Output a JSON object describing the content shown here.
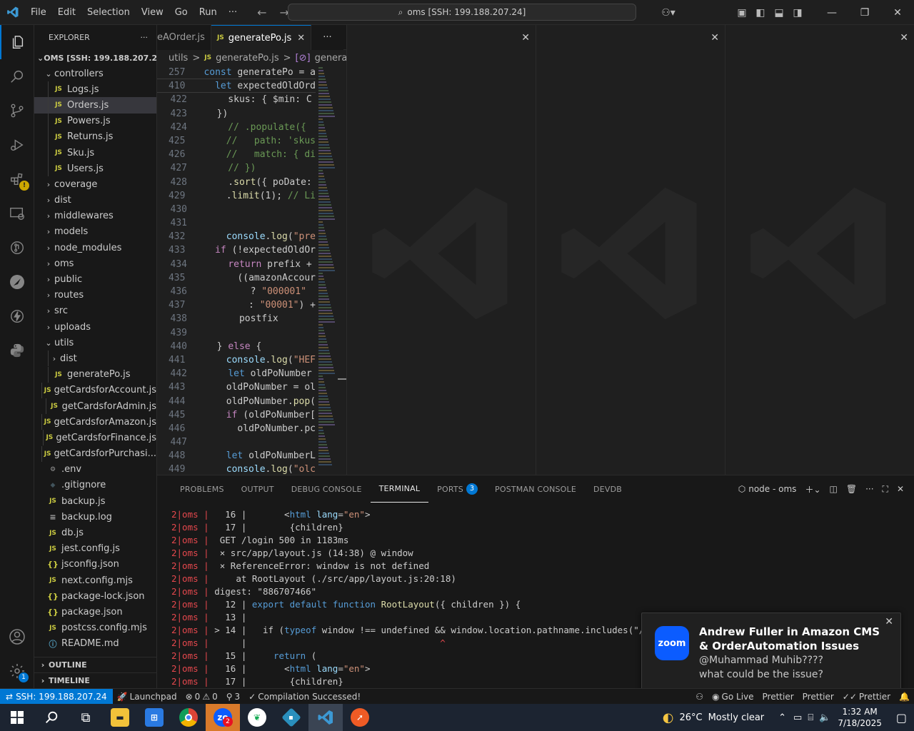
{
  "titlebar": {
    "menu": [
      "File",
      "Edit",
      "Selection",
      "View",
      "Go",
      "Run",
      "···"
    ],
    "command_center": "oms [SSH: 199.188.207.24]"
  },
  "explorer": {
    "header": "EXPLORER",
    "root": "OMS [SSH: 199.188.207.24]",
    "items": [
      {
        "label": "controllers",
        "kind": "folder-open",
        "depth": 1
      },
      {
        "label": "Logs.js",
        "kind": "js",
        "depth": 2
      },
      {
        "label": "Orders.js",
        "kind": "js",
        "depth": 2,
        "selected": true
      },
      {
        "label": "Powers.js",
        "kind": "js",
        "depth": 2
      },
      {
        "label": "Returns.js",
        "kind": "js",
        "depth": 2
      },
      {
        "label": "Sku.js",
        "kind": "js",
        "depth": 2
      },
      {
        "label": "Users.js",
        "kind": "js",
        "depth": 2
      },
      {
        "label": "coverage",
        "kind": "folder",
        "depth": 1
      },
      {
        "label": "dist",
        "kind": "folder",
        "depth": 1
      },
      {
        "label": "middlewares",
        "kind": "folder",
        "depth": 1
      },
      {
        "label": "models",
        "kind": "folder",
        "depth": 1
      },
      {
        "label": "node_modules",
        "kind": "folder",
        "depth": 1
      },
      {
        "label": "oms",
        "kind": "folder",
        "depth": 1
      },
      {
        "label": "public",
        "kind": "folder",
        "depth": 1
      },
      {
        "label": "routes",
        "kind": "folder",
        "depth": 1
      },
      {
        "label": "src",
        "kind": "folder",
        "depth": 1
      },
      {
        "label": "uploads",
        "kind": "folder",
        "depth": 1
      },
      {
        "label": "utils",
        "kind": "folder-open",
        "depth": 1
      },
      {
        "label": "dist",
        "kind": "folder",
        "depth": 2
      },
      {
        "label": "generatePo.js",
        "kind": "js",
        "depth": 2
      },
      {
        "label": "getCardsforAccount.js",
        "kind": "js",
        "depth": 2
      },
      {
        "label": "getCardsforAdmin.js",
        "kind": "js",
        "depth": 2
      },
      {
        "label": "getCardsforAmazon.js",
        "kind": "js",
        "depth": 2
      },
      {
        "label": "getCardsforFinance.js",
        "kind": "js",
        "depth": 2
      },
      {
        "label": "getCardsforPurchasi...",
        "kind": "js",
        "depth": 2
      },
      {
        "label": ".env",
        "kind": "env",
        "depth": 1
      },
      {
        "label": ".gitignore",
        "kind": "git",
        "depth": 1
      },
      {
        "label": "backup.js",
        "kind": "js",
        "depth": 1
      },
      {
        "label": "backup.log",
        "kind": "log",
        "depth": 1
      },
      {
        "label": "db.js",
        "kind": "js",
        "depth": 1
      },
      {
        "label": "jest.config.js",
        "kind": "js",
        "depth": 1
      },
      {
        "label": "jsconfig.json",
        "kind": "json",
        "depth": 1
      },
      {
        "label": "next.config.mjs",
        "kind": "js",
        "depth": 1
      },
      {
        "label": "package-lock.json",
        "kind": "json",
        "depth": 1
      },
      {
        "label": "package.json",
        "kind": "json",
        "depth": 1
      },
      {
        "label": "postcss.config.mjs",
        "kind": "js",
        "depth": 1
      },
      {
        "label": "README.md",
        "kind": "md",
        "depth": 1
      }
    ],
    "outline": "OUTLINE",
    "timeline": "TIMELINE"
  },
  "editor": {
    "tabs": [
      {
        "label": "eAOrder.js",
        "active": false
      },
      {
        "label": "generatePo.js",
        "active": true
      }
    ],
    "tab_more": "···",
    "breadcrumbs": [
      "utils",
      ">",
      "generatePo.js",
      ">",
      "generatePo"
    ],
    "sticky": [
      {
        "n": "257",
        "code": "const generatePo = a"
      },
      {
        "n": "410",
        "code": "  let expectedOldOrd"
      }
    ],
    "lines": [
      {
        "n": "422",
        "code": "    skus: { $min: C"
      },
      {
        "n": "423",
        "code": "  })"
      },
      {
        "n": "424",
        "code": "    // .populate({"
      },
      {
        "n": "425",
        "code": "    //   path: 'skus"
      },
      {
        "n": "426",
        "code": "    //   match: { di"
      },
      {
        "n": "427",
        "code": "    // })"
      },
      {
        "n": "428",
        "code": "    .sort({ poDate:"
      },
      {
        "n": "429",
        "code": "    .limit(1); // Li"
      },
      {
        "n": "430",
        "code": ""
      },
      {
        "n": "431",
        "code": ""
      },
      {
        "n": "432",
        "code": "    console.log(\"pre"
      },
      {
        "n": "433",
        "code": "  if (!expectedOldOr"
      },
      {
        "n": "434",
        "code": "    return prefix +"
      },
      {
        "n": "435",
        "code": "      ((amazonAccour"
      },
      {
        "n": "436",
        "code": "        ? \"000001\""
      },
      {
        "n": "437",
        "code": "        : \"00001\") +"
      },
      {
        "n": "438",
        "code": "      postfix"
      },
      {
        "n": "439",
        "code": ""
      },
      {
        "n": "440",
        "code": "  } else {"
      },
      {
        "n": "441",
        "code": "    console.log(\"HEF"
      },
      {
        "n": "442",
        "code": "    let oldPoNumber"
      },
      {
        "n": "443",
        "code": "    oldPoNumber = ol"
      },
      {
        "n": "444",
        "code": "    oldPoNumber.pop("
      },
      {
        "n": "445",
        "code": "    if (oldPoNumber["
      },
      {
        "n": "446",
        "code": "      oldPoNumber.pc"
      },
      {
        "n": "447",
        "code": ""
      },
      {
        "n": "448",
        "code": "    let oldPoNumberL"
      },
      {
        "n": "449",
        "code": "    console.log(\"olc"
      }
    ]
  },
  "panel": {
    "tabs": [
      "PROBLEMS",
      "OUTPUT",
      "DEBUG CONSOLE",
      "TERMINAL",
      "PORTS",
      "POSTMAN CONSOLE",
      "DEVDB"
    ],
    "ports_badge": "3",
    "terminal_name": "node - oms",
    "lines": [
      {
        "p": "2|oms",
        "sep": " | ",
        "body": "  16 |       <html lang=\"en\">"
      },
      {
        "p": "2|oms",
        "sep": " | ",
        "body": "  17 |        {children}"
      },
      {
        "p": "2|oms",
        "sep": " | ",
        "body": " GET /login 500 in 1183ms"
      },
      {
        "p": "2|oms",
        "sep": " | ",
        "body": " ⨯ src/app/layout.js (14:38) @ window"
      },
      {
        "p": "2|oms",
        "sep": " | ",
        "body": " ⨯ ReferenceError: window is not defined"
      },
      {
        "p": "2|oms",
        "sep": " | ",
        "body": "    at RootLayout (./src/app/layout.js:20:18)"
      },
      {
        "p": "2|oms",
        "sep": " | ",
        "body": "digest: \"886707466\""
      },
      {
        "p": "2|oms",
        "sep": " | ",
        "body": "  12 | export default function RootLayout({ children }) {"
      },
      {
        "p": "2|oms",
        "sep": " | ",
        "body": "  13 |"
      },
      {
        "p": "2|oms",
        "sep": " | ",
        "body": "> 14 |   if (typeof window !== undefined && window.location.pathname.includes(\"/order"
      },
      {
        "p": "2|oms",
        "sep": " | ",
        "body": "     |                                    ^"
      },
      {
        "p": "2|oms",
        "sep": " | ",
        "body": "  15 |     return ("
      },
      {
        "p": "2|oms",
        "sep": " | ",
        "body": "  16 |       <html lang=\"en\">"
      },
      {
        "p": "2|oms",
        "sep": " | ",
        "body": "  17 |        {children}"
      }
    ]
  },
  "notification": {
    "app": "zoom",
    "title": "Andrew Fuller in Amazon CMS & OrderAutomation Issues",
    "line1": "@Muhammad Muhib????",
    "line2": "what could be the issue?"
  },
  "status": {
    "remote": "SSH: 199.188.207.24",
    "launchpad": "Launchpad",
    "errors": "0",
    "warnings": "0",
    "ports": "3",
    "compile": "Compilation Successed!",
    "right": [
      "Go Live",
      "Prettier",
      "Prettier",
      "Prettier"
    ]
  },
  "taskbar": {
    "weather_temp": "26°C",
    "weather_text": "Mostly clear",
    "time": "1:32 AM",
    "date": "7/18/2025",
    "zoom_badge": "2"
  },
  "activity_badges": {
    "accounts": "1"
  },
  "colors": {
    "accent": "#0078d4",
    "remote": "#0078d4",
    "zoom": "#0b5cff"
  }
}
